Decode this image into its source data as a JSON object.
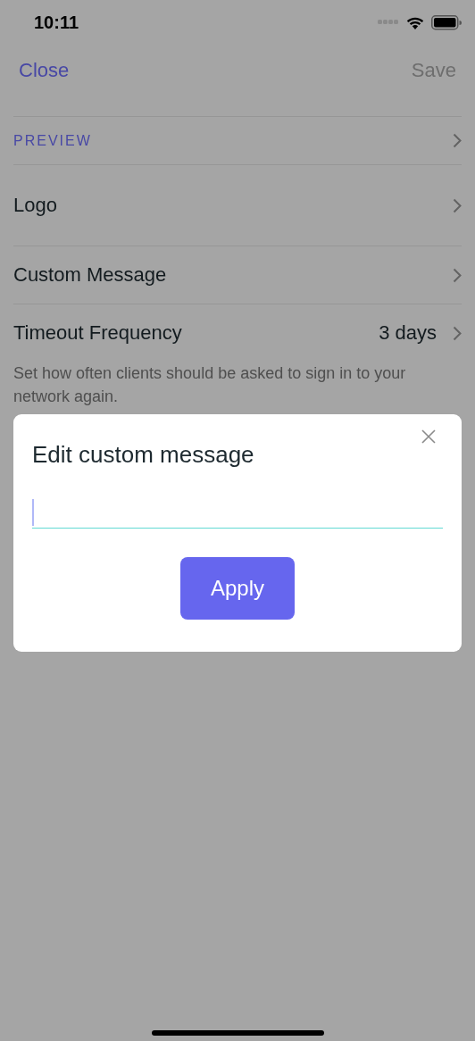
{
  "status_bar": {
    "time": "10:11"
  },
  "nav": {
    "close": "Close",
    "save": {
      "label": "Save",
      "disabled": true
    }
  },
  "section": {
    "label": "PREVIEW"
  },
  "rows": [
    {
      "kind": "tall",
      "label": "Logo"
    },
    {
      "kind": "plain",
      "label": "Custom Message"
    },
    {
      "kind": "value",
      "label": "Timeout Frequency",
      "value": "3 days"
    }
  ],
  "help_text": "Set how often clients should be asked to sign in to your network again.",
  "dialog": {
    "title": "Edit custom message",
    "apply": "Apply"
  }
}
